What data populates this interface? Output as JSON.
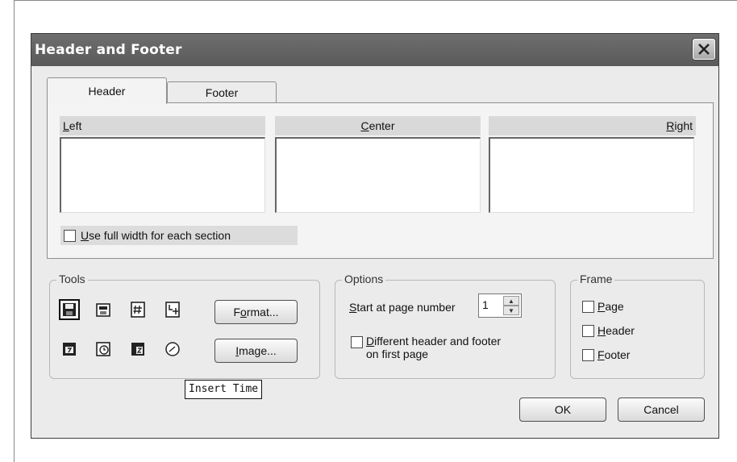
{
  "dialog": {
    "title": "Header and Footer",
    "close_icon": "close-x-icon"
  },
  "tabs": [
    {
      "label": "Header",
      "active": true
    },
    {
      "label": "Footer",
      "active": false
    }
  ],
  "sections": {
    "left": {
      "mnemonic": "L",
      "rest": "eft"
    },
    "center": {
      "mnemonic": "C",
      "rest": "enter"
    },
    "right": {
      "mnemonic": "R",
      "rest": "ight"
    }
  },
  "full_width": {
    "mnemonic": "U",
    "rest": "se full width for each section",
    "checked": false
  },
  "tools": {
    "title": "Tools",
    "icons": [
      "save-icon",
      "printer-icon",
      "page-number-icon",
      "page-count-icon",
      "insert-date-icon",
      "insert-clock-icon",
      "insert-timezone-icon",
      "insert-time-icon"
    ],
    "format": {
      "before": "F",
      "mnemonic": "o",
      "rest": "rmat..."
    },
    "image": {
      "mnemonic": "I",
      "rest": "mage..."
    }
  },
  "tooltip": "Insert Time",
  "options": {
    "title": "Options",
    "start_label": {
      "mnemonic": "S",
      "rest": "tart at page number"
    },
    "start_value": "1",
    "different_first": {
      "mnemonic": "D",
      "rest": "ifferent header and footer",
      "line2": "on first page",
      "checked": false
    }
  },
  "frame": {
    "title": "Frame",
    "page": {
      "mnemonic": "P",
      "rest": "age",
      "checked": false
    },
    "header": {
      "mnemonic": "H",
      "rest": "eader",
      "checked": false
    },
    "footer": {
      "mnemonic": "F",
      "rest": "ooter",
      "checked": false
    }
  },
  "buttons": {
    "ok": "OK",
    "cancel": "Cancel"
  }
}
